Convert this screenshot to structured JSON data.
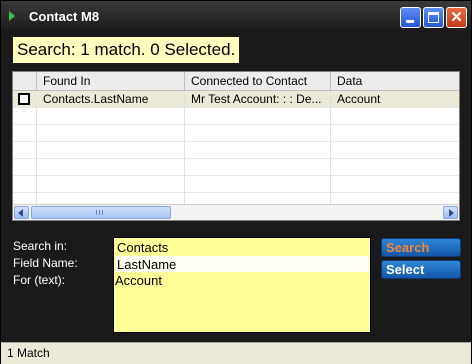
{
  "window": {
    "title": "Contact M8"
  },
  "search_status": "Search: 1 match.  0 Selected.",
  "grid": {
    "columns": [
      "Found In",
      "Connected to Contact",
      "Data"
    ],
    "rows": [
      {
        "checked": false,
        "found_in": "Contacts.LastName",
        "connected_to": "Mr Test Account: : : De...",
        "data": "Account"
      }
    ]
  },
  "form": {
    "search_in_label": "Search in:",
    "field_name_label": "Field Name:",
    "for_text_label": "For (text):",
    "search_in_value": "Contacts",
    "field_name_value": "LastName",
    "for_text_value": "Account"
  },
  "buttons": {
    "search": "Search",
    "select": "Select"
  },
  "colors": {
    "search_button_text": "#f0883a",
    "select_button_text": "#ffffff",
    "highlight": "#ffff99"
  },
  "statusbar": {
    "text": "1 Match"
  }
}
